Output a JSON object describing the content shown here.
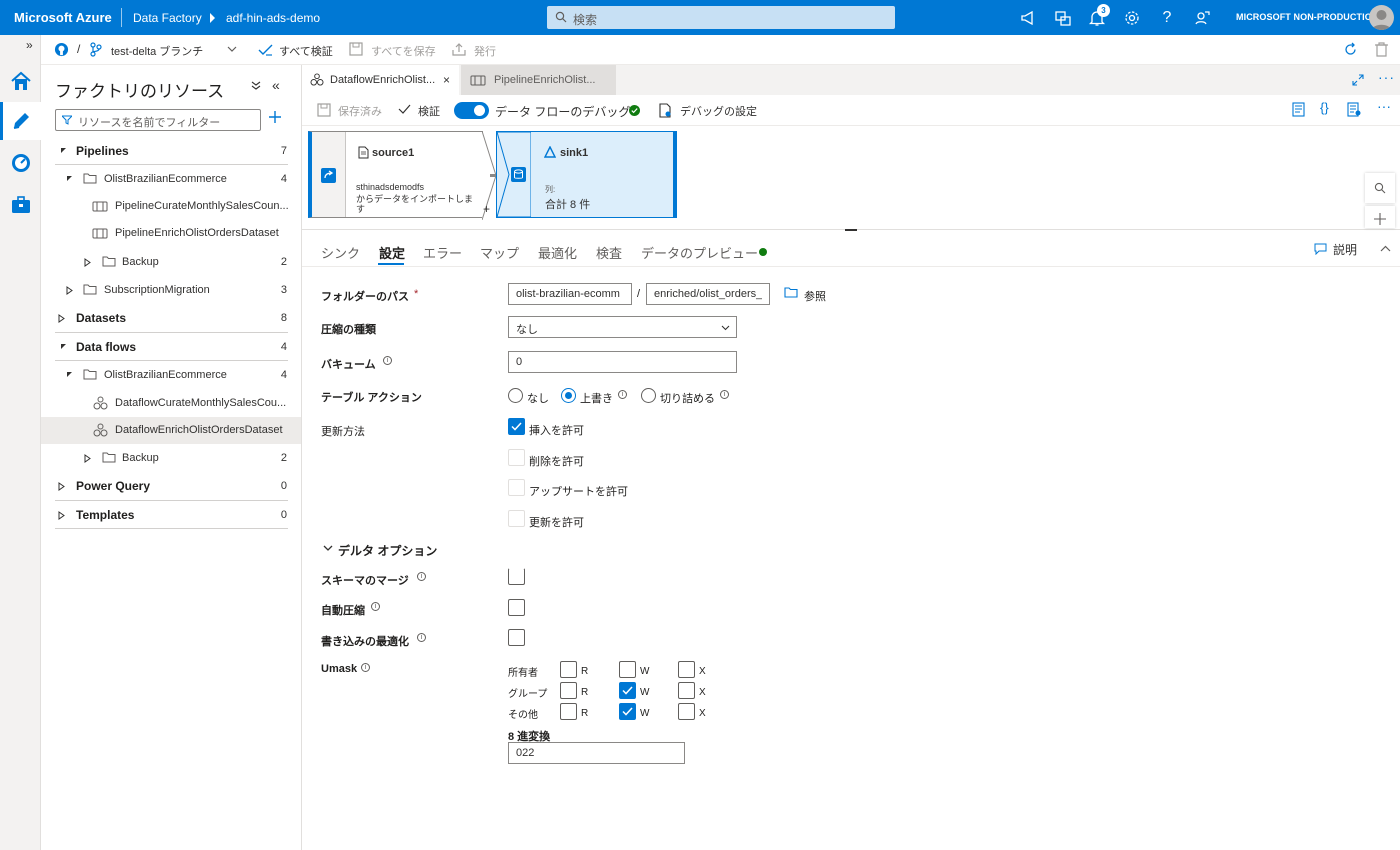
{
  "topbar": {
    "brand": "Microsoft Azure",
    "service": "Data Factory",
    "factory": "adf-hin-ads-demo",
    "search_placeholder": "検索",
    "notification_count": "3",
    "environment": "MICROSOFT NON-PRODUCTION"
  },
  "toolbar": {
    "branch": "test-delta ブランチ",
    "validate_all": "すべて検証",
    "save_all": "すべてを保存",
    "publish": "発行"
  },
  "resources": {
    "title": "ファクトリのリソース",
    "filter_placeholder": "リソースを名前でフィルター",
    "pipelines": {
      "label": "Pipelines",
      "count": "7"
    },
    "pipelines_folder1": {
      "label": "OlistBrazilianEcommerce",
      "count": "4"
    },
    "pipeline_item1": "PipelineCurateMonthlySalesCoun...",
    "pipeline_item2": "PipelineEnrichOlistOrdersDataset",
    "pipelines_backup": {
      "label": "Backup",
      "count": "2"
    },
    "pipelines_folder2": {
      "label": "SubscriptionMigration",
      "count": "3"
    },
    "datasets": {
      "label": "Datasets",
      "count": "8"
    },
    "dataflows": {
      "label": "Data flows",
      "count": "4"
    },
    "dataflows_folder1": {
      "label": "OlistBrazilianEcommerce",
      "count": "4"
    },
    "dataflow_item1": "DataflowCurateMonthlySalesCou...",
    "dataflow_item2": "DataflowEnrichOlistOrdersDataset",
    "dataflows_backup": {
      "label": "Backup",
      "count": "2"
    },
    "powerquery": {
      "label": "Power Query",
      "count": "0"
    },
    "templates": {
      "label": "Templates",
      "count": "0"
    }
  },
  "tabs": [
    {
      "label": "DataflowEnrichOlist..."
    },
    {
      "label": "PipelineEnrichOlist..."
    }
  ],
  "dftool": {
    "saved": "保存済み",
    "validate": "検証",
    "debug_toggle": "データ フローのデバッグ",
    "debug_settings": "デバッグの設定"
  },
  "canvas": {
    "source_name": "source1",
    "source_desc1": "sthinadsdemodfs",
    "source_desc2": "からデータをインポートしま",
    "source_desc3": "す",
    "plus": "+",
    "sink_name": "sink1",
    "sink_col_label": "列:",
    "sink_col_value": "合計 8 件"
  },
  "settings_tabs": [
    "シンク",
    "設定",
    "エラー",
    "マップ",
    "最適化",
    "検査",
    "データのプレビュー"
  ],
  "settings_description": "説明",
  "form": {
    "folder_path_label": "フォルダーのパス",
    "required_mark": "*",
    "folder_path_container": "olist-brazilian-ecomm",
    "path_sep": "/",
    "folder_path_dir": "enriched/olist_orders_",
    "browse": "参照",
    "compression_label": "圧縮の種類",
    "compression_value": "なし",
    "vacuum_label": "バキューム",
    "vacuum_value": "0",
    "table_action_label": "テーブル アクション",
    "table_action_none": "なし",
    "table_action_overwrite": "上書き",
    "table_action_truncate": "切り詰める",
    "update_method_label": "更新方法",
    "allow_insert": "挿入を許可",
    "allow_delete": "削除を許可",
    "allow_upsert": "アップサートを許可",
    "allow_update": "更新を許可",
    "delta_options": "デルタ オプション",
    "schema_merge": "スキーマのマージ",
    "auto_compact": "自動圧縮",
    "optimize_write": "書き込みの最適化",
    "umask_label": "Umask",
    "umask_rows": [
      {
        "label": "所有者",
        "r": false,
        "w": false,
        "x": false
      },
      {
        "label": "グループ",
        "r": false,
        "w": true,
        "x": false
      },
      {
        "label": "その他",
        "r": false,
        "w": true,
        "x": false
      }
    ],
    "umask_r": "R",
    "umask_w": "W",
    "umask_x": "X",
    "octal_label": "8 進変換",
    "octal_value": "022"
  },
  "colors": {
    "accent": "#0078d4",
    "ok_green": "#107c10"
  }
}
